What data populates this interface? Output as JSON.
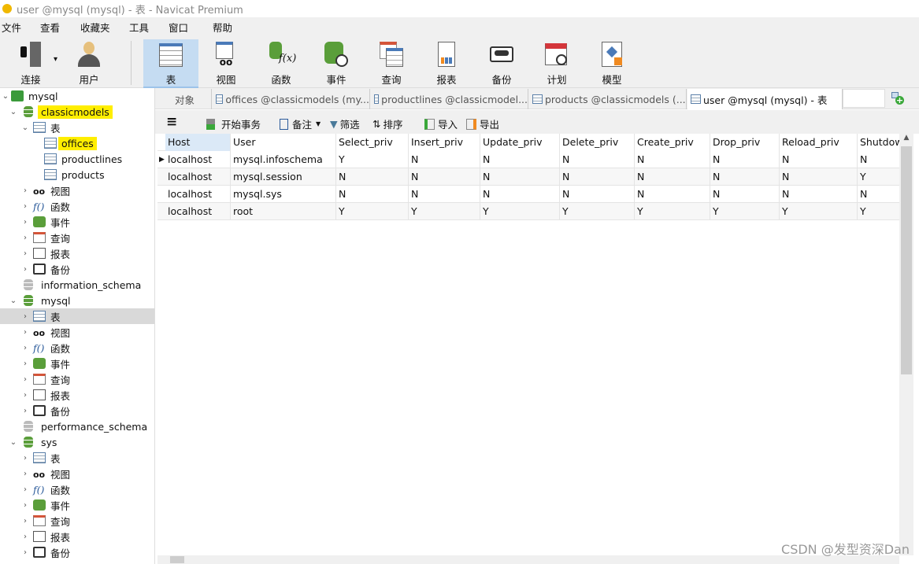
{
  "window": {
    "title": "user @mysql (mysql) - 表 - Navicat Premium"
  },
  "menu": [
    "文件",
    "查看",
    "收藏夹",
    "工具",
    "窗口",
    "帮助"
  ],
  "toolbar": {
    "items": [
      {
        "label": "连接",
        "icon": "plug-server-icon"
      },
      {
        "label": "用户",
        "icon": "user-icon"
      },
      {
        "label": "表",
        "icon": "table-icon",
        "active": true
      },
      {
        "label": "视图",
        "icon": "view-glasses-icon"
      },
      {
        "label": "函数",
        "icon": "function-icon"
      },
      {
        "label": "事件",
        "icon": "event-clock-icon"
      },
      {
        "label": "查询",
        "icon": "query-icon"
      },
      {
        "label": "报表",
        "icon": "report-icon"
      },
      {
        "label": "备份",
        "icon": "backup-icon"
      },
      {
        "label": "计划",
        "icon": "schedule-calendar-icon"
      },
      {
        "label": "模型",
        "icon": "model-icon"
      }
    ]
  },
  "tree": [
    {
      "label": "mysql",
      "level": 0,
      "icon": "connection",
      "expanded": true
    },
    {
      "label": "classicmodels",
      "level": 1,
      "icon": "db",
      "expanded": true,
      "highlight": true
    },
    {
      "label": "表",
      "level": 2,
      "icon": "table",
      "expanded": true
    },
    {
      "label": "offices",
      "level": 3,
      "icon": "table",
      "highlight": true
    },
    {
      "label": "productlines",
      "level": 3,
      "icon": "table"
    },
    {
      "label": "products",
      "level": 3,
      "icon": "table"
    },
    {
      "label": "视图",
      "level": 2,
      "icon": "view",
      "collapsed": true
    },
    {
      "label": "函数",
      "level": 2,
      "icon": "func",
      "collapsed": true
    },
    {
      "label": "事件",
      "level": 2,
      "icon": "event",
      "collapsed": true
    },
    {
      "label": "查询",
      "level": 2,
      "icon": "query",
      "collapsed": true
    },
    {
      "label": "报表",
      "level": 2,
      "icon": "report",
      "collapsed": true
    },
    {
      "label": "备份",
      "level": 2,
      "icon": "backup",
      "collapsed": true
    },
    {
      "label": "information_schema",
      "level": 1,
      "icon": "dbgray"
    },
    {
      "label": "mysql",
      "level": 1,
      "icon": "db",
      "expanded": true
    },
    {
      "label": "表",
      "level": 2,
      "icon": "table",
      "collapsed": true,
      "selected": true
    },
    {
      "label": "视图",
      "level": 2,
      "icon": "view",
      "collapsed": true
    },
    {
      "label": "函数",
      "level": 2,
      "icon": "func",
      "collapsed": true
    },
    {
      "label": "事件",
      "level": 2,
      "icon": "event",
      "collapsed": true
    },
    {
      "label": "查询",
      "level": 2,
      "icon": "query",
      "collapsed": true
    },
    {
      "label": "报表",
      "level": 2,
      "icon": "report",
      "collapsed": true
    },
    {
      "label": "备份",
      "level": 2,
      "icon": "backup",
      "collapsed": true
    },
    {
      "label": "performance_schema",
      "level": 1,
      "icon": "dbgray"
    },
    {
      "label": "sys",
      "level": 1,
      "icon": "db",
      "expanded": true
    },
    {
      "label": "表",
      "level": 2,
      "icon": "table",
      "collapsed": true
    },
    {
      "label": "视图",
      "level": 2,
      "icon": "view",
      "collapsed": true
    },
    {
      "label": "函数",
      "level": 2,
      "icon": "func",
      "collapsed": true
    },
    {
      "label": "事件",
      "level": 2,
      "icon": "event",
      "collapsed": true
    },
    {
      "label": "查询",
      "level": 2,
      "icon": "query",
      "collapsed": true
    },
    {
      "label": "报表",
      "level": 2,
      "icon": "report",
      "collapsed": true
    },
    {
      "label": "备份",
      "level": 2,
      "icon": "backup",
      "collapsed": true
    }
  ],
  "tabs": [
    {
      "label": "对象"
    },
    {
      "label": "offices @classicmodels (my..."
    },
    {
      "label": "productlines @classicmodel..."
    },
    {
      "label": "products @classicmodels (..."
    },
    {
      "label": "user @mysql (mysql) - 表",
      "active": true
    }
  ],
  "subtoolbar": {
    "begin_transaction": "开始事务",
    "comment": "备注",
    "filter": "筛选",
    "sort": "排序",
    "import": "导入",
    "export": "导出"
  },
  "table": {
    "columns": [
      "Host",
      "User",
      "Select_priv",
      "Insert_priv",
      "Update_priv",
      "Delete_priv",
      "Create_priv",
      "Drop_priv",
      "Reload_priv",
      "Shutdow"
    ],
    "rows": [
      [
        "localhost",
        "mysql.infoschema",
        "Y",
        "N",
        "N",
        "N",
        "N",
        "N",
        "N",
        "N"
      ],
      [
        "localhost",
        "mysql.session",
        "N",
        "N",
        "N",
        "N",
        "N",
        "N",
        "N",
        "Y"
      ],
      [
        "localhost",
        "mysql.sys",
        "N",
        "N",
        "N",
        "N",
        "N",
        "N",
        "N",
        "N"
      ],
      [
        "localhost",
        "root",
        "Y",
        "Y",
        "Y",
        "Y",
        "Y",
        "Y",
        "Y",
        "Y"
      ]
    ]
  },
  "watermark": "CSDN @发型资深Dan",
  "colors": {
    "accent": "#c5dcf2",
    "highlight": "#ffee00",
    "db_green": "#5a9e3a"
  }
}
